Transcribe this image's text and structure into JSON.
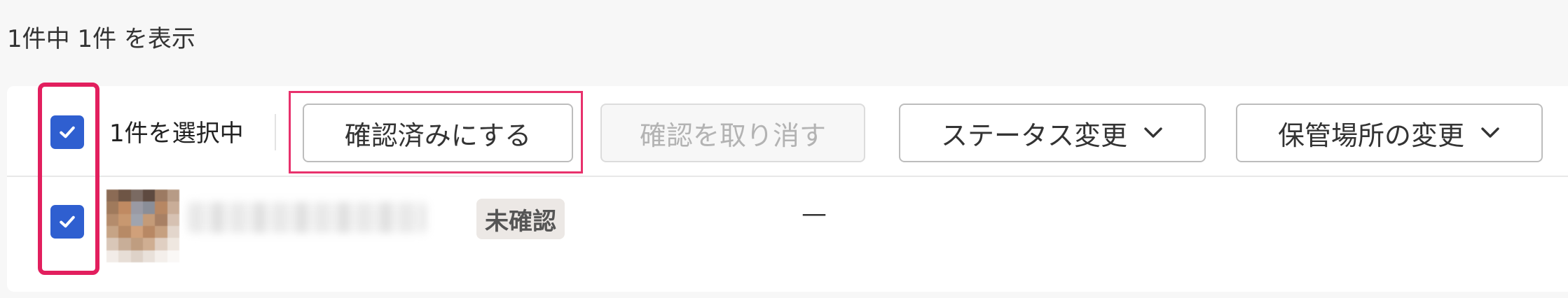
{
  "summary": {
    "result_count_text": "1件中 1件 を表示"
  },
  "toolbar": {
    "selected_text": "1件を選択中",
    "buttons": {
      "confirm": "確認済みにする",
      "cancel_confirm": "確認を取り消す",
      "change_status": "ステータス変更",
      "change_location": "保管場所の変更"
    }
  },
  "rows": [
    {
      "status_badge": "未確認",
      "location": "—"
    }
  ],
  "colors": {
    "accent": "#2f5fd0",
    "highlight": "#e21f5e"
  }
}
